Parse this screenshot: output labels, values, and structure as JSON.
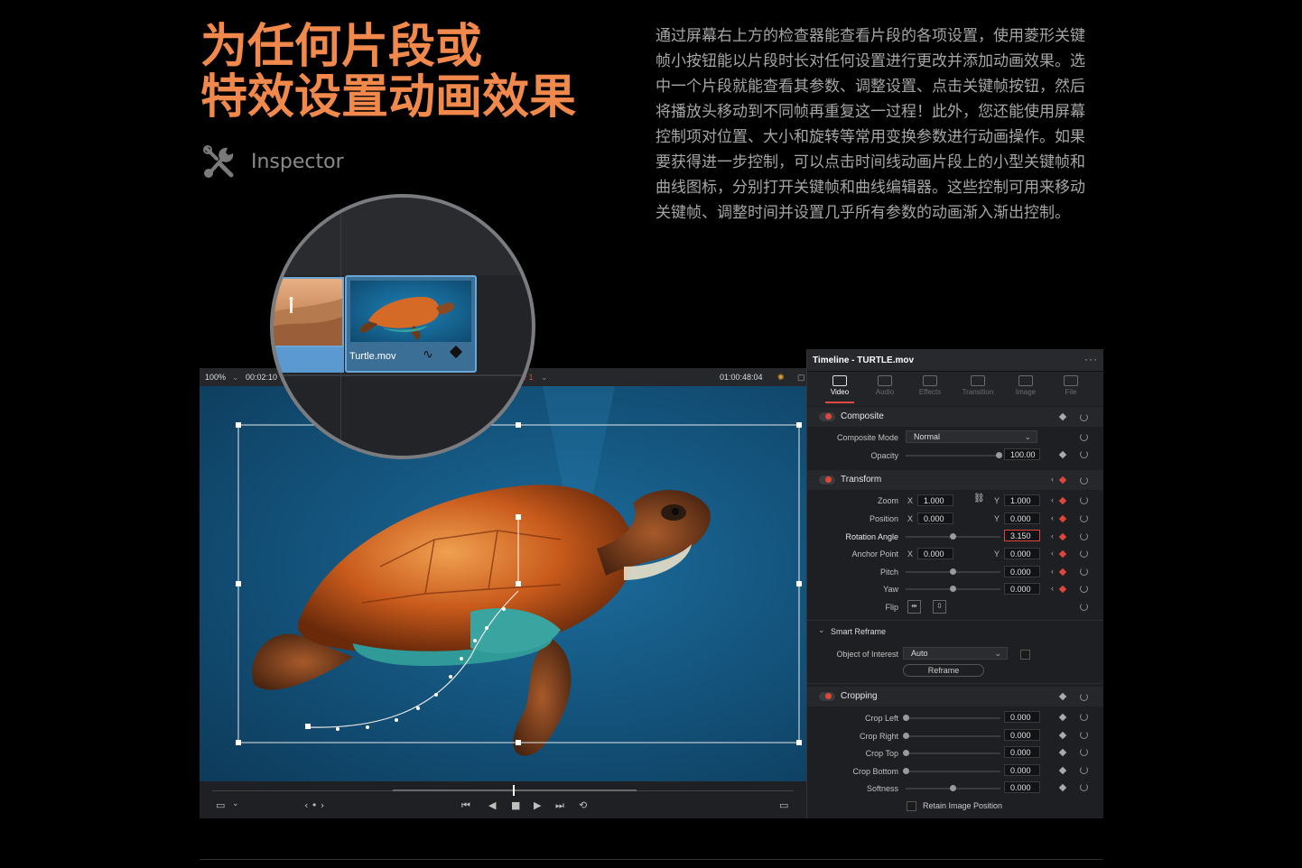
{
  "headline": {
    "line1": "为任何片段或",
    "line2": "特效设置动画效果"
  },
  "feature": {
    "icon": "inspector-tools-icon",
    "label": "Inspector"
  },
  "description": "通过屏幕右上方的检查器能查看片段的各项设置，使用菱形关键帧小按钮能以片段时长对任何设置进行更改并添加动画效果。选中一个片段就能查看其参数、调整设置、点击关键帧按钮，然后将播放头移动到不同帧再重复这一过程！此外，您还能使用屏幕控制项对位置、大小和旋转等常用变换参数进行动画操作。如果要获得进一步控制，可以点击时间线动画片段上的小型关键帧和曲线图标，分别打开关键帧和曲线编辑器。这些控制可用来移动关键帧、调整时间并设置几乎所有参数的动画渐入渐出控制。",
  "viewer": {
    "zoom": "100%",
    "timecode_left": "00:02:10",
    "timeline_name_fragment": "e 1",
    "timecode_right": "01:00:48:04"
  },
  "magnifier": {
    "clip_name": "Turtle.mov"
  },
  "inspector": {
    "title": "Timeline - TURTLE.mov",
    "menu_icon": "more-icon",
    "tabs": [
      {
        "label": "Video",
        "active": true
      },
      {
        "label": "Audio"
      },
      {
        "label": "Effects"
      },
      {
        "label": "Transition"
      },
      {
        "label": "Image"
      },
      {
        "label": "File"
      }
    ],
    "composite": {
      "title": "Composite",
      "mode_label": "Composite Mode",
      "mode_value": "Normal",
      "opacity_label": "Opacity",
      "opacity_value": "100.00"
    },
    "transform": {
      "title": "Transform",
      "zoom_label": "Zoom",
      "zoom_x": "1.000",
      "zoom_y": "1.000",
      "position_label": "Position",
      "position_x": "0.000",
      "position_y": "0.000",
      "rotation_label": "Rotation Angle",
      "rotation_value": "3.150",
      "anchor_label": "Anchor Point",
      "anchor_x": "0.000",
      "anchor_y": "0.000",
      "pitch_label": "Pitch",
      "pitch_value": "0.000",
      "yaw_label": "Yaw",
      "yaw_value": "0.000",
      "flip_label": "Flip",
      "x": "X",
      "y": "Y"
    },
    "smart_reframe": {
      "title": "Smart Reframe",
      "object_label": "Object of Interest",
      "object_value": "Auto",
      "button": "Reframe"
    },
    "cropping": {
      "title": "Cropping",
      "crop_left_label": "Crop Left",
      "crop_left": "0.000",
      "crop_right_label": "Crop Right",
      "crop_right": "0.000",
      "crop_top_label": "Crop Top",
      "crop_top": "0.000",
      "crop_bottom_label": "Crop Bottom",
      "crop_bottom": "0.000",
      "softness_label": "Softness",
      "softness": "0.000",
      "retain_label": "Retain Image Position"
    }
  },
  "colors": {
    "accent": "#f0894b",
    "keyframe_red": "#e0453c"
  }
}
